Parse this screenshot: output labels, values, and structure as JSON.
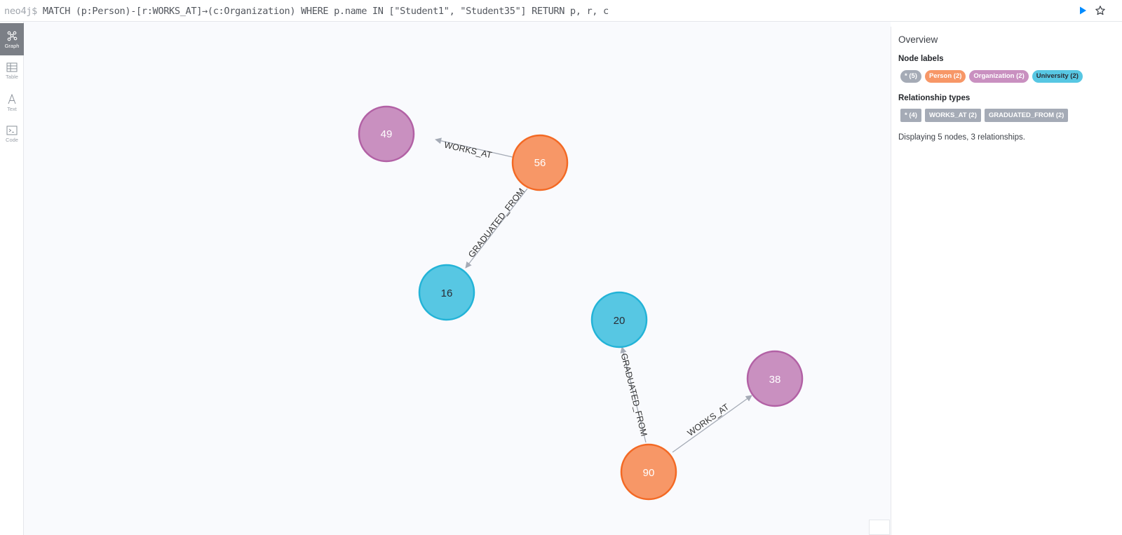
{
  "query_bar": {
    "prompt": "neo4j$",
    "query": "MATCH (p:Person)-[r:WORKS_AT]→(c:Organization) WHERE p.name IN [\"Student1\", \"Student35\"] RETURN p, r, c"
  },
  "sidebar": {
    "items": [
      {
        "label": "Graph",
        "icon": "graph-icon",
        "active": true
      },
      {
        "label": "Table",
        "icon": "table-icon",
        "active": false
      },
      {
        "label": "Text",
        "icon": "text-icon",
        "active": false
      },
      {
        "label": "Code",
        "icon": "code-icon",
        "active": false
      }
    ]
  },
  "colors": {
    "person_fill": "#f79767",
    "person_stroke": "#f36924",
    "organization_fill": "#c990c0",
    "organization_stroke": "#b261a5",
    "university_fill": "#57c7e3",
    "university_stroke": "#23b3d7",
    "edge": "#a5abb6",
    "run_button": "#018bff"
  },
  "graph": {
    "nodes": [
      {
        "id": "49",
        "label": "Organization"
      },
      {
        "id": "56",
        "label": "Person"
      },
      {
        "id": "16",
        "label": "University"
      },
      {
        "id": "20",
        "label": "University"
      },
      {
        "id": "38",
        "label": "Organization"
      },
      {
        "id": "90",
        "label": "Person"
      }
    ],
    "relationships": [
      {
        "from": "56",
        "to": "49",
        "type": "WORKS_AT"
      },
      {
        "from": "56",
        "to": "16",
        "type": "GRADUATED_FROM"
      },
      {
        "from": "90",
        "to": "20",
        "type": "GRADUATED_FROM"
      },
      {
        "from": "90",
        "to": "38",
        "type": "WORKS_AT"
      }
    ]
  },
  "overview": {
    "title": "Overview",
    "node_labels_heading": "Node labels",
    "node_labels": [
      {
        "text": "* (5)",
        "color": "#a5abb6",
        "text_color": "#ffffff"
      },
      {
        "text": "Person (2)",
        "color": "#f79767",
        "text_color": "#ffffff"
      },
      {
        "text": "Organization (2)",
        "color": "#c990c0",
        "text_color": "#ffffff"
      },
      {
        "text": "University (2)",
        "color": "#57c7e3",
        "text_color": "#2a2c34"
      }
    ],
    "rel_types_heading": "Relationship types",
    "rel_types": [
      {
        "text": "* (4)"
      },
      {
        "text": "WORKS_AT (2)"
      },
      {
        "text": "GRADUATED_FROM (2)"
      }
    ],
    "summary": "Displaying 5 nodes, 3 relationships."
  }
}
